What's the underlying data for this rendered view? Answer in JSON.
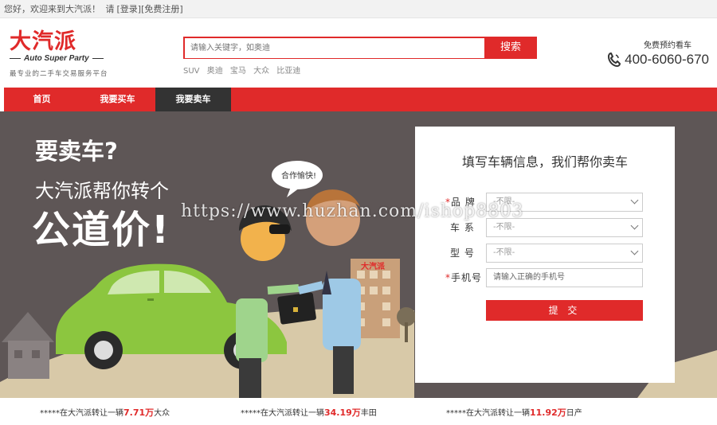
{
  "topbar": {
    "greeting": "您好，欢迎来到大汽派！",
    "please": "请",
    "login": "[登录]",
    "register": "[免费注册]"
  },
  "logo": {
    "cn": "大汽派",
    "en": "Auto Super Party",
    "slogan": "最专业的二手车交易服务平台"
  },
  "search": {
    "placeholder": "请输入关键字，如奥迪",
    "button": "搜索",
    "hot_keys": [
      "SUV",
      "奥迪",
      "宝马",
      "大众",
      "比亚迪"
    ]
  },
  "hotline": {
    "label": "免费预约看车",
    "number": "400-6060-670",
    "icon": "phone-icon"
  },
  "nav": {
    "items": [
      {
        "label": "首页"
      },
      {
        "label": "我要买车"
      },
      {
        "label": "我要卖车"
      }
    ],
    "active_index": 2
  },
  "banner": {
    "line1": "要卖车?",
    "line2": "大汽派帮你转个",
    "line3": "公道价!",
    "speech_bubble": "合作愉快!",
    "building_sign": "大汽派",
    "watermark": "https://www.huzhan.com/ishop8803"
  },
  "form": {
    "title": "填写车辆信息，我们帮你卖车",
    "brand_label": "品  牌",
    "brand_value": "-不限-",
    "series_label": "车  系",
    "series_value": "-不限-",
    "model_label": "型  号",
    "model_value": "-不限-",
    "phone_label": "手机号",
    "phone_placeholder": "请输入正确的手机号",
    "required_mark": "*",
    "submit": "提 交"
  },
  "ticker": [
    {
      "prefix": "*****在大汽派转让一辆",
      "price": "7.71万",
      "suffix": "大众"
    },
    {
      "prefix": "*****在大汽派转让一辆",
      "price": "34.19万",
      "suffix": "丰田"
    },
    {
      "prefix": "*****在大汽派转让一辆",
      "price": "11.92万",
      "suffix": "日产"
    }
  ],
  "colors": {
    "brand_red": "#e02a2a",
    "nav_active": "#333333",
    "banner_bg": "#5e5656",
    "car_green": "#8cc63f"
  }
}
